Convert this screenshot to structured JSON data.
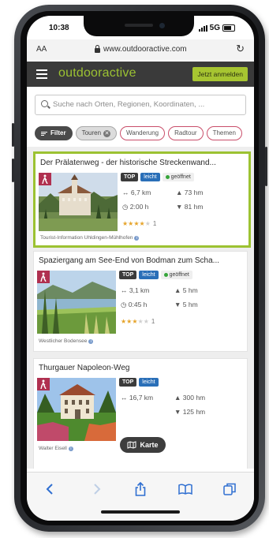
{
  "status_bar": {
    "time": "10:38",
    "network": "5G"
  },
  "browser": {
    "text_size_label": "AA",
    "url": "www.outdooractive.com"
  },
  "app": {
    "logo": "outdooractive",
    "login_label": "Jetzt anmelden"
  },
  "search": {
    "placeholder": "Suche nach Orten, Regionen, Koordinaten, ..."
  },
  "filters": {
    "filter_label": "Filter",
    "active_chip": "Touren",
    "chips": [
      "Wanderung",
      "Radtour",
      "Themen"
    ]
  },
  "colors": {
    "brand_green": "#9cc232",
    "header_dark": "#3a3a3a",
    "category_red": "#b03050",
    "easy_blue": "#2a6fb8",
    "open_green": "#36a53a"
  },
  "tours": [
    {
      "title": "Der Prälatenweg - der historische Streckenwand...",
      "badges": {
        "top": "TOP",
        "difficulty": "leicht",
        "status": "geöffnet"
      },
      "distance": "6,7 km",
      "duration": "2:00 h",
      "ascent": "73 hm",
      "descent": "81 hm",
      "rating": 4,
      "reviews": "1",
      "source": "Tourist-Information Uhldingen-Mühlhofen",
      "category_icon": "hiking-icon"
    },
    {
      "title": "Spaziergang am See-End von Bodman zum Scha...",
      "badges": {
        "top": "TOP",
        "difficulty": "leicht",
        "status": "geöffnet"
      },
      "distance": "3,1 km",
      "duration": "0:45 h",
      "ascent": "5 hm",
      "descent": "5 hm",
      "rating": 3,
      "reviews": "1",
      "source": "Westlicher Bodensee",
      "category_icon": "hiking-icon"
    },
    {
      "title": "Thurgauer Napoleon-Weg",
      "badges": {
        "top": "TOP",
        "difficulty": "leicht"
      },
      "distance": "16,7 km",
      "ascent": "300 hm",
      "descent": "125 hm",
      "source": "Walter Eisell",
      "category_icon": "hiking-icon"
    }
  ],
  "map_button": {
    "label": "Karte"
  }
}
